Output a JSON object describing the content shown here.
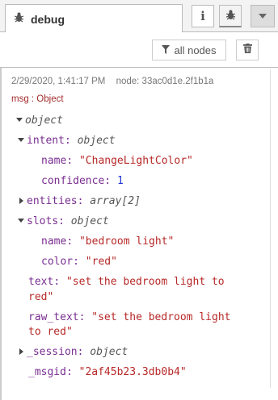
{
  "header": {
    "tab_label": "debug",
    "info_icon_label": "i"
  },
  "toolbar": {
    "filter_label": "all nodes"
  },
  "message": {
    "timestamp": "2/29/2020, 1:41:17 PM",
    "node": "node: 33ac0d1e.2f1b1a",
    "topic": "msg : Object",
    "root_type": "object",
    "intent": {
      "key": "intent",
      "type": "object",
      "name_key": "name",
      "name_value": "\"ChangeLightColor\"",
      "confidence_key": "confidence",
      "confidence_value": "1"
    },
    "entities": {
      "key": "entities",
      "type": "array[2]"
    },
    "slots": {
      "key": "slots",
      "type": "object",
      "name_key": "name",
      "name_value": "\"bedroom light\"",
      "color_key": "color",
      "color_value": "\"red\""
    },
    "text": {
      "key": "text",
      "value_line1": "\"set the bedroom light to",
      "value_line2": "red\""
    },
    "raw_text": {
      "key": "raw_text",
      "value_line1": "\"set the bedroom light",
      "value_line2": "to red\""
    },
    "session": {
      "key": "_session",
      "type": "object"
    },
    "msgid": {
      "key": "_msgid",
      "value": "\"2af45b23.3db0b4\""
    }
  }
}
